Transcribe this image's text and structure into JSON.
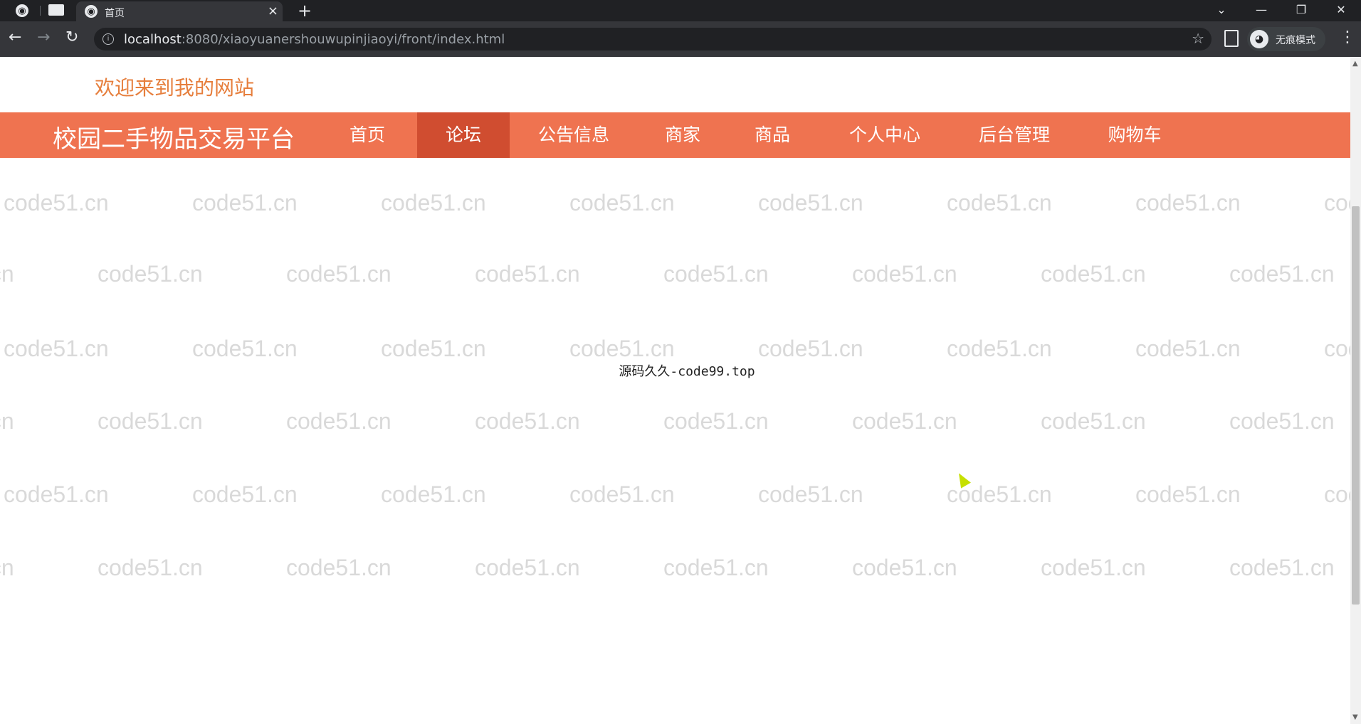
{
  "browser": {
    "tab_title": "首页",
    "tab_close": "×",
    "new_tab": "+",
    "url_host": "localhost",
    "url_rest": ":8080/xiaoyuanershouwupinjiaoyi/front/index.html",
    "incognito_label": "无痕模式",
    "back": "←",
    "forward": "→",
    "reload": "↻",
    "star": "☆",
    "menu": "⋮",
    "minimize": "—",
    "restore": "❐",
    "close": "✕",
    "tab_search": "⌄"
  },
  "page": {
    "welcome": "欢迎来到我的网站",
    "brand": "校园二手物品交易平台",
    "nav": [
      "首页",
      "论坛",
      "公告信息",
      "商家",
      "商品",
      "个人中心",
      "后台管理",
      "购物车"
    ],
    "active_nav": "论坛",
    "center_text": "源码久久-code99.top",
    "watermark": "code51.cn",
    "accent_color": "#ef7350",
    "active_color": "#d04d30",
    "welcome_color": "#e67e3c"
  }
}
